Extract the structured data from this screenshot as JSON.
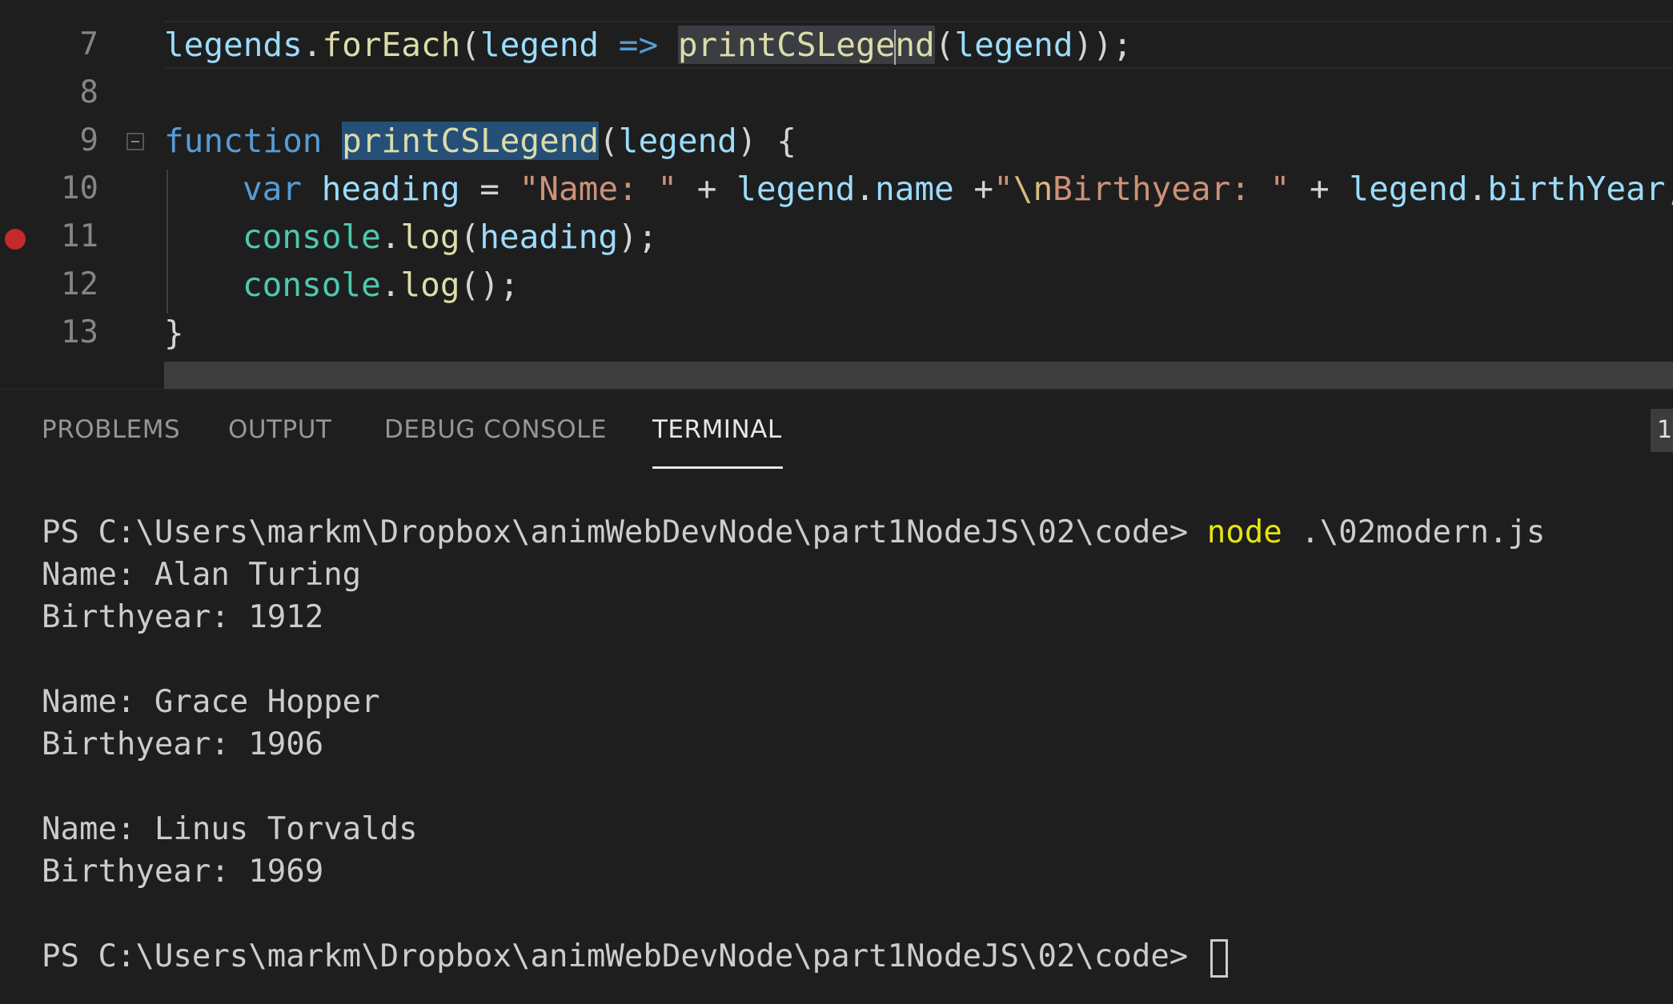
{
  "editor": {
    "lines": [
      {
        "num": "7"
      },
      {
        "num": "8"
      },
      {
        "num": "9"
      },
      {
        "num": "10"
      },
      {
        "num": "11"
      },
      {
        "num": "12"
      },
      {
        "num": "13"
      }
    ],
    "line7": {
      "legends": "legends",
      "dot1": ".",
      "forEach": "forEach",
      "paren_open": "(",
      "legend": "legend",
      "arrow": " => ",
      "printCSLege": "printCSLege",
      "nd": "nd",
      "paren_arg": "(",
      "legend2": "legend",
      "close": "));"
    },
    "line9": {
      "function": "function",
      "fn_name": "printCSLegend",
      "paren_open": "(",
      "param": "legend",
      "rest": ") {"
    },
    "line10": {
      "var": "var",
      "heading": "heading",
      "eq": " = ",
      "str1": "\"Name: \"",
      "plus1": " + ",
      "legend": "legend",
      "dot": ".",
      "name": "name",
      "plus2": " +",
      "str2_open": "\"",
      "escape": "\\n",
      "str2_rest": "Birthyear: \"",
      "plus3": " + ",
      "legend2": "legend",
      "dot2": ".",
      "birthYear": "birthYear",
      "semi": ";"
    },
    "line11": {
      "console": "console",
      "dot": ".",
      "log": "log",
      "paren": "(",
      "arg": "heading",
      "close": ");"
    },
    "line12": {
      "console": "console",
      "dot": ".",
      "log": "log",
      "close": "();"
    },
    "line13": {
      "brace": "}"
    }
  },
  "panel": {
    "tabs": {
      "problems": "PROBLEMS",
      "output": "OUTPUT",
      "debug_console": "DEBUG CONSOLE",
      "terminal": "TERMINAL"
    },
    "badge": "1"
  },
  "terminal": {
    "prompt": "PS C:\\Users\\markm\\Dropbox\\animWebDevNode\\part1NodeJS\\02\\code> ",
    "command": "node",
    "command_arg": " .\\02modern.js",
    "output": [
      "Name: Alan Turing",
      "Birthyear: 1912",
      "",
      "Name: Grace Hopper",
      "Birthyear: 1906",
      "",
      "Name: Linus Torvalds",
      "Birthyear: 1969",
      ""
    ],
    "final_prompt": "PS C:\\Users\\markm\\Dropbox\\animWebDevNode\\part1NodeJS\\02\\code> "
  },
  "colors": {
    "background": "#1e1e1e",
    "keyword": "#569cd6",
    "variable": "#9cdcfe",
    "function": "#dcdcaa",
    "string": "#ce9178",
    "type": "#4ec9b0",
    "command": "#e5e510",
    "breakpoint": "#c52a2a",
    "selection": "#264f78"
  }
}
